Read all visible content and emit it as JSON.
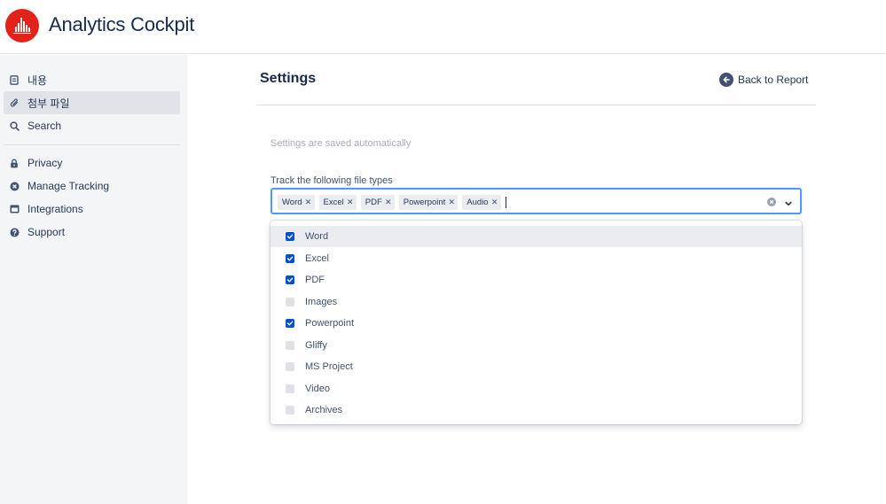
{
  "app": {
    "title": "Analytics Cockpit"
  },
  "sidebar": {
    "items": [
      {
        "label": "내용",
        "icon": "page-icon"
      },
      {
        "label": "첨부 파일",
        "icon": "paperclip-icon",
        "active": true
      },
      {
        "label": "Search",
        "icon": "search-icon"
      },
      {
        "label": "Privacy",
        "icon": "lock-icon"
      },
      {
        "label": "Manage Tracking",
        "icon": "cross-circle-icon"
      },
      {
        "label": "Integrations",
        "icon": "window-icon"
      },
      {
        "label": "Support",
        "icon": "question-circle-icon"
      }
    ]
  },
  "main": {
    "title": "Settings",
    "back_label": "Back to Report",
    "autosave_note": "Settings are saved automatically",
    "field_label": "Track the following file types",
    "selected": [
      "Word",
      "Excel",
      "PDF",
      "Powerpoint",
      "Audio"
    ],
    "options": [
      {
        "label": "Word",
        "checked": true,
        "highlighted": true
      },
      {
        "label": "Excel",
        "checked": true
      },
      {
        "label": "PDF",
        "checked": true
      },
      {
        "label": "Images",
        "checked": false
      },
      {
        "label": "Powerpoint",
        "checked": true
      },
      {
        "label": "Gliffy",
        "checked": false
      },
      {
        "label": "MS Project",
        "checked": false
      },
      {
        "label": "Video",
        "checked": false
      },
      {
        "label": "Archives",
        "checked": false
      }
    ]
  },
  "colors": {
    "brand": "#e2231a",
    "focus": "#4c9aff",
    "checked": "#0052cc",
    "sidebar_bg": "#f4f5f7"
  }
}
